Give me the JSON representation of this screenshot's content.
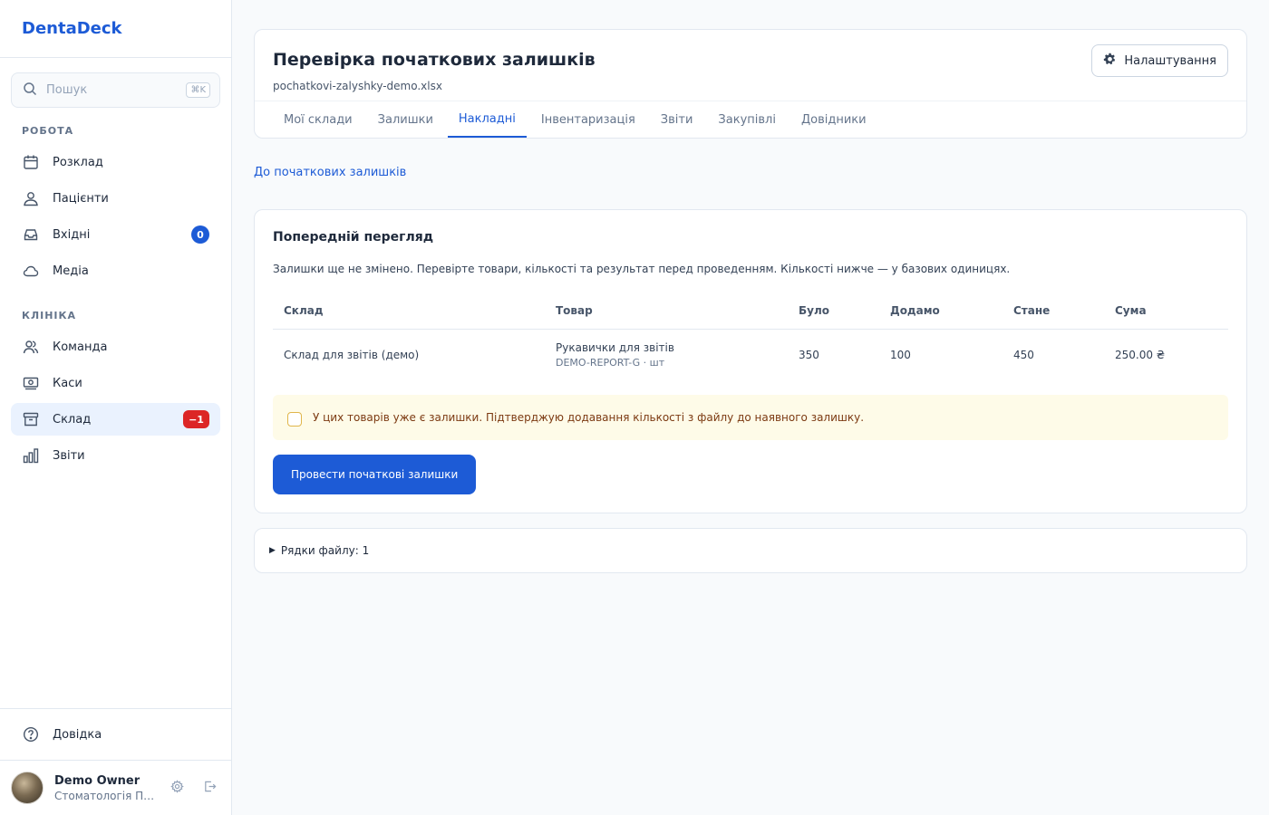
{
  "brand": "DentaDeck",
  "search": {
    "placeholder": "Пошук",
    "shortcut": "⌘K"
  },
  "sidebar": {
    "sections": [
      {
        "title": "РОБОТА",
        "items": [
          {
            "label": "Розклад",
            "icon": "calendar-icon"
          },
          {
            "label": "Пацієнти",
            "icon": "users-icon"
          },
          {
            "label": "Вхідні",
            "icon": "inbox-icon",
            "badge": "0"
          },
          {
            "label": "Медіа",
            "icon": "cloud-icon"
          }
        ]
      },
      {
        "title": "КЛІНІКА",
        "items": [
          {
            "label": "Команда",
            "icon": "team-icon"
          },
          {
            "label": "Каси",
            "icon": "cash-icon"
          },
          {
            "label": "Склад",
            "icon": "archive-icon",
            "badge": "−1",
            "active": true
          },
          {
            "label": "Звіти",
            "icon": "chart-icon"
          }
        ]
      }
    ],
    "help": "Довідка",
    "user": {
      "name": "Demo Owner",
      "org": "Стоматологія Посмішка"
    }
  },
  "header": {
    "title": "Перевірка початкових залишків",
    "subtitle": "pochatkovi-zalyshky-demo.xlsx",
    "settings_label": "Налаштування",
    "tabs": [
      "Мої склади",
      "Залишки",
      "Накладні",
      "Інвентаризація",
      "Звіти",
      "Закупівлі",
      "Довідники"
    ],
    "active_tab": "Накладні"
  },
  "back_link": "До початкових залишків",
  "preview": {
    "title": "Попередній перегляд",
    "description": "Залишки ще не змінено. Перевірте товари, кількості та результат перед проведенням. Кількості нижче — у базових одиницях.",
    "columns": [
      "Склад",
      "Товар",
      "Було",
      "Додамо",
      "Стане",
      "Сума"
    ],
    "rows": [
      {
        "warehouse": "Склад для звітів (демо)",
        "product": "Рукавички для звітів",
        "product_code": "DEMO-REPORT-G · шт",
        "was": "350",
        "add": "100",
        "will_be": "450",
        "sum": "250.00 ₴"
      }
    ],
    "confirm_text": "У цих товарів уже є залишки. Підтверджую додавання кількості з файлу до наявного залишку.",
    "confirm_checked": false,
    "submit_label": "Провести початкові залишки"
  },
  "file_rows_label": "Рядки файлу: 1",
  "colors": {
    "accent": "#1d5bd6",
    "danger": "#dc2626",
    "warning_bg": "#fefbe8"
  }
}
